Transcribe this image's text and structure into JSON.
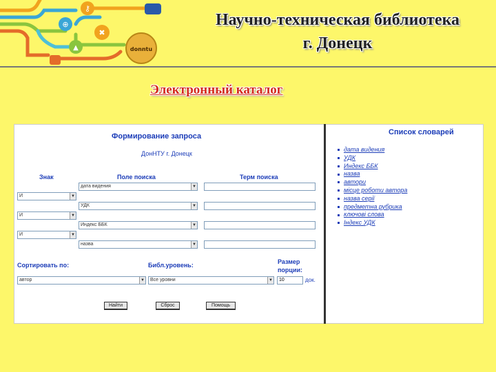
{
  "header": {
    "title_line1": "Научно-техническая библиотека",
    "title_line2": "г. Донецк",
    "logo_text": "donntu"
  },
  "subtitle": "Электронный каталог",
  "form": {
    "title": "Формирование запроса",
    "subtitle": "ДонНТУ г. Донецк",
    "col_sign": "Знак",
    "col_field": "Поле поиска",
    "col_term": "Терм поиска",
    "rows": [
      {
        "sign": "",
        "field": "дата видения",
        "term": ""
      },
      {
        "sign": "И",
        "field": "УДК",
        "term": ""
      },
      {
        "sign": "И",
        "field": "Индекс ББК",
        "term": ""
      },
      {
        "sign": "И",
        "field": "назва",
        "term": ""
      }
    ],
    "sort_label": "Сортировать по:",
    "sort_value": "автор",
    "level_label": "Библ.уровень:",
    "level_value": "Все уровни",
    "portion_label_1": "Размер",
    "portion_label_2": "порции:",
    "portion_value": "10",
    "portion_unit": "док.",
    "buttons": {
      "find": "Найти",
      "reset": "Сброс",
      "help": "Помощь"
    }
  },
  "dictionaries": {
    "title": "Список словарей",
    "items": [
      "дата видения",
      "УДК",
      "Индекс ББК",
      "назва",
      "автори",
      "місце роботи автора",
      "назва серії",
      "предметна рубрика",
      "ключові слова",
      "Індекс УДК"
    ]
  },
  "colors": {
    "background": "#fdf76a",
    "title_red": "#d42b1e",
    "link_blue": "#1c3db8"
  }
}
